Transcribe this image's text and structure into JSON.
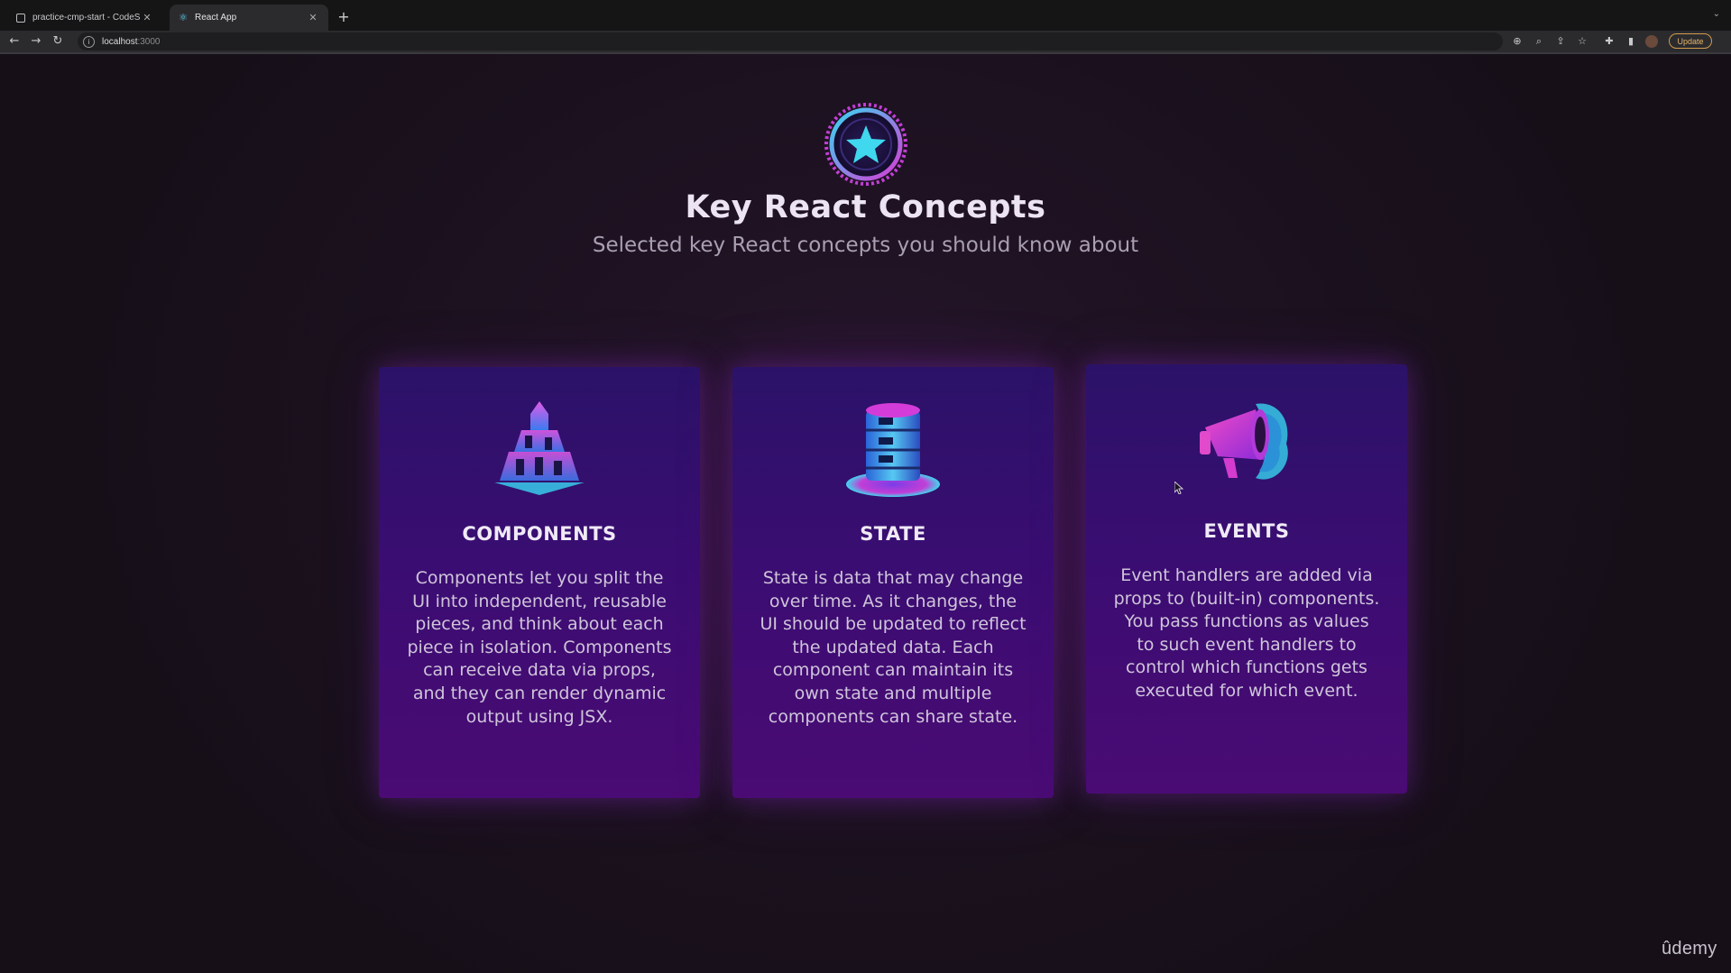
{
  "browser": {
    "tabs": [
      {
        "title": "practice-cmp-start - CodeSan",
        "active": false
      },
      {
        "title": "React App",
        "active": true
      }
    ],
    "new_tab": "+",
    "url_host": "localhost",
    "url_port": ":3000",
    "update_label": "Update"
  },
  "header": {
    "title": "Key React Concepts",
    "subtitle": "Selected key React concepts you should know about"
  },
  "concepts": [
    {
      "title": "COMPONENTS",
      "description": "Components let you split the UI into independent, reusable pieces, and think about each piece in isolation. Components can receive data via props, and they can render dynamic output using JSX.",
      "icon": "components-icon"
    },
    {
      "title": "STATE",
      "description": "State is data that may change over time. As it changes, the UI should be updated to reflect the updated data. Each component can maintain its own state and multiple components can share state.",
      "icon": "state-icon"
    },
    {
      "title": "EVENTS",
      "description": "Event handlers are added via props to (built-in) components. You pass functions as values to such event handlers to control which functions gets executed for which event.",
      "icon": "events-icon"
    }
  ],
  "watermark": "ûdemy",
  "colors": {
    "accent_pink": "#e040d8",
    "accent_cyan": "#38e0f0",
    "card_top": "#2b1268",
    "card_bottom": "#4a0b74",
    "background": "#171019"
  }
}
